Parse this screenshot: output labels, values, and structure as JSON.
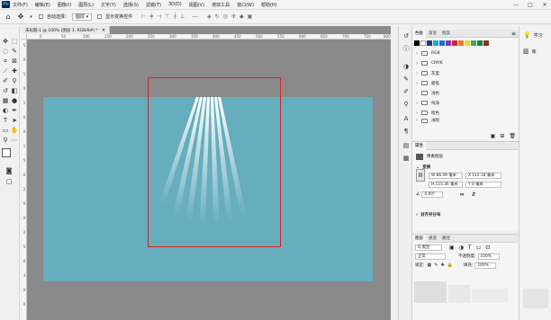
{
  "menubar": {
    "logo": "Ps",
    "items": [
      "文件(F)",
      "编辑(E)",
      "图像(I)",
      "图层(L)",
      "文字(Y)",
      "选择(S)",
      "滤镜(T)",
      "3D(D)",
      "视图(V)",
      "增效工具",
      "窗口(W)",
      "帮助(H)"
    ],
    "window_controls": [
      "—",
      "□",
      "✕"
    ]
  },
  "options_bar": {
    "auto_select_label": "自动选择：",
    "auto_select_value": "图层",
    "show_transform_label": "显示变换控件",
    "more": "···"
  },
  "document": {
    "tab_title": "未标题-1 @ 100% (图层 1, RGB/8#) *",
    "ruler_h": [
      "0",
      "50",
      "100",
      "150",
      "200",
      "250",
      "300",
      "350",
      "400",
      "450",
      "500",
      "550",
      "600",
      "650",
      "700",
      "750",
      "800"
    ],
    "ruler_v": [
      "5",
      "0",
      "5",
      "0",
      "1",
      "0",
      "0",
      "1",
      "5",
      "0",
      "2",
      "0",
      "0",
      "2",
      "5",
      "0",
      "3",
      "0",
      "0"
    ],
    "canvas_color": "#66adbd",
    "selection_color": "#d22222"
  },
  "swatches_panel": {
    "tabs": [
      "色板",
      "渐变",
      "图案"
    ],
    "colors": [
      "#000000",
      "#ffffff",
      "#1c3f7a",
      "#13a8e0",
      "#1d6fc8",
      "#7a3fb1",
      "#d61f33",
      "#e87a2e",
      "#f7d52a",
      "#41a55a",
      "#1f7f4c",
      "#7f3d1a"
    ],
    "folders": [
      "RGB",
      "CMYK",
      "灰度",
      "蜡笔",
      "浅色",
      "纯净",
      "暗色",
      "浅暗"
    ]
  },
  "properties_panel": {
    "title": "属性",
    "layer_type": "像素图层",
    "transform_title": "变换",
    "w": "W 86.09 毫米",
    "x": "X 112.18 毫米",
    "h": "H 115.36 毫米",
    "y": "Y 0 毫米",
    "angle": "0.00°",
    "align_title": "对齐并分布"
  },
  "layers_panel": {
    "tabs": [
      "图层",
      "通道",
      "路径"
    ],
    "filter": "Q 类型",
    "blend_mode": "正常",
    "opacity_label": "不透明度:",
    "opacity_value": "100%",
    "lock_label": "锁定:",
    "fill_label": "填充:",
    "fill_value": "100%"
  },
  "learn_panel": {
    "learn_label": "学习",
    "library_label": "库"
  }
}
